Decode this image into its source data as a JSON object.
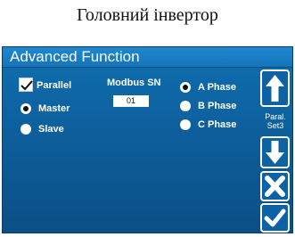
{
  "caption": "Головний інвертор",
  "window": {
    "title": "Advanced Function"
  },
  "options": {
    "parallel": {
      "label": "Parallel",
      "checked": true
    },
    "master": {
      "label": "Master",
      "selected": true
    },
    "slave": {
      "label": "Slave",
      "selected": false
    }
  },
  "modbus": {
    "label": "Modbus SN",
    "value": "01"
  },
  "phases": [
    {
      "label": "A Phase",
      "selected": true
    },
    {
      "label": "B Phase",
      "selected": false
    },
    {
      "label": "C Phase",
      "selected": false
    }
  ],
  "sidebar": {
    "paral_label_1": "Paral.",
    "paral_label_2": "Set3"
  },
  "icons": {
    "up": "arrow-up-icon",
    "down": "arrow-down-icon",
    "cancel": "close-icon",
    "confirm": "checkmark-icon"
  },
  "colors": {
    "panel": "#0d5f9c",
    "titlebar": "#1574b8",
    "text": "#ffffff"
  }
}
